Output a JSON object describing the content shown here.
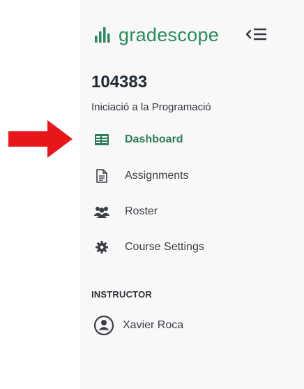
{
  "brand": {
    "name": "gradescope",
    "color": "#2a8c5e"
  },
  "header": {
    "collapse_icon": "collapse-sidebar-icon"
  },
  "course": {
    "number": "104383",
    "name": "Iniciació a la Programació"
  },
  "nav": {
    "items": [
      {
        "label": "Dashboard",
        "icon": "dashboard-icon",
        "active": true
      },
      {
        "label": "Assignments",
        "icon": "document-icon",
        "active": false
      },
      {
        "label": "Roster",
        "icon": "people-icon",
        "active": false
      },
      {
        "label": "Course Settings",
        "icon": "gear-icon",
        "active": false
      }
    ]
  },
  "instructor": {
    "section_label": "INSTRUCTOR",
    "name": "Xavier Roca",
    "icon": "user-avatar-icon"
  },
  "annotation": {
    "type": "red-arrow",
    "color": "#e8161b",
    "points_to": "Dashboard"
  }
}
